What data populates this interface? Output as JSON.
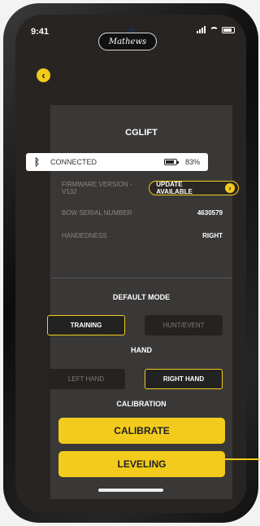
{
  "status_bar": {
    "time": "9:41"
  },
  "brand": {
    "logo_text": "Mathews"
  },
  "device": {
    "title": "CGLIFT",
    "connection_status": "CONNECTED",
    "battery": "83%",
    "battery_level": 0.83
  },
  "info": {
    "firmware_label": "FIRMWARE VERSION - V132",
    "update_label": "UPDATE AVAILABLE",
    "serial_label": "BOW SERIAL NUMBER",
    "serial_value": "4630579",
    "handedness_label": "HANDEDNESS",
    "handedness_value": "RIGHT"
  },
  "default_mode": {
    "label": "DEFAULT MODE",
    "options": [
      "TRAINING",
      "HUNT/EVENT"
    ],
    "selected": "TRAINING"
  },
  "hand": {
    "label": "HAND",
    "options": [
      "LEFT HAND",
      "RIGHT HAND"
    ],
    "selected": "RIGHT HAND"
  },
  "calibration": {
    "label": "CALIBRATION",
    "calibrate_button": "CALIBRATE",
    "leveling_button": "LEVELING"
  },
  "colors": {
    "accent": "#f2cb1c",
    "panel": "#3a3837",
    "background": "#272422"
  }
}
